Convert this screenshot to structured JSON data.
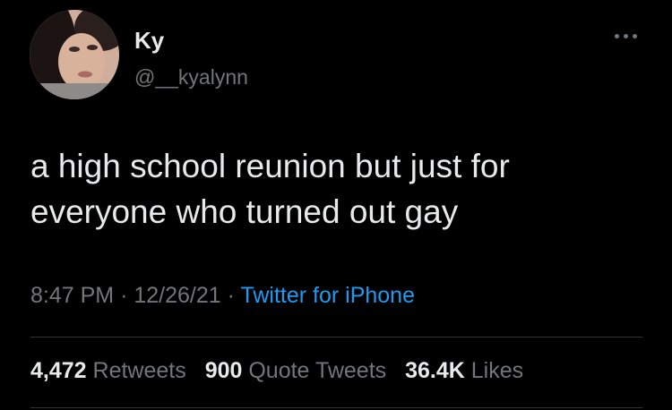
{
  "user": {
    "display_name": "Ky",
    "handle": "@__kyalynn"
  },
  "tweet": {
    "text": "a high school reunion but just for everyone who turned out gay"
  },
  "meta": {
    "time": "8:47 PM",
    "separator": "·",
    "date": "12/26/21",
    "source": "Twitter for iPhone"
  },
  "stats": {
    "retweets_count": "4,472",
    "retweets_label": "Retweets",
    "quote_count": "900",
    "quote_label": "Quote Tweets",
    "likes_count": "36.4K",
    "likes_label": "Likes"
  },
  "icons": {
    "more": "more-options-icon"
  },
  "colors": {
    "background": "#000000",
    "text": "#e7e9ea",
    "secondary": "#71767b",
    "link": "#1d9bf0",
    "divider": "#2f3336"
  }
}
